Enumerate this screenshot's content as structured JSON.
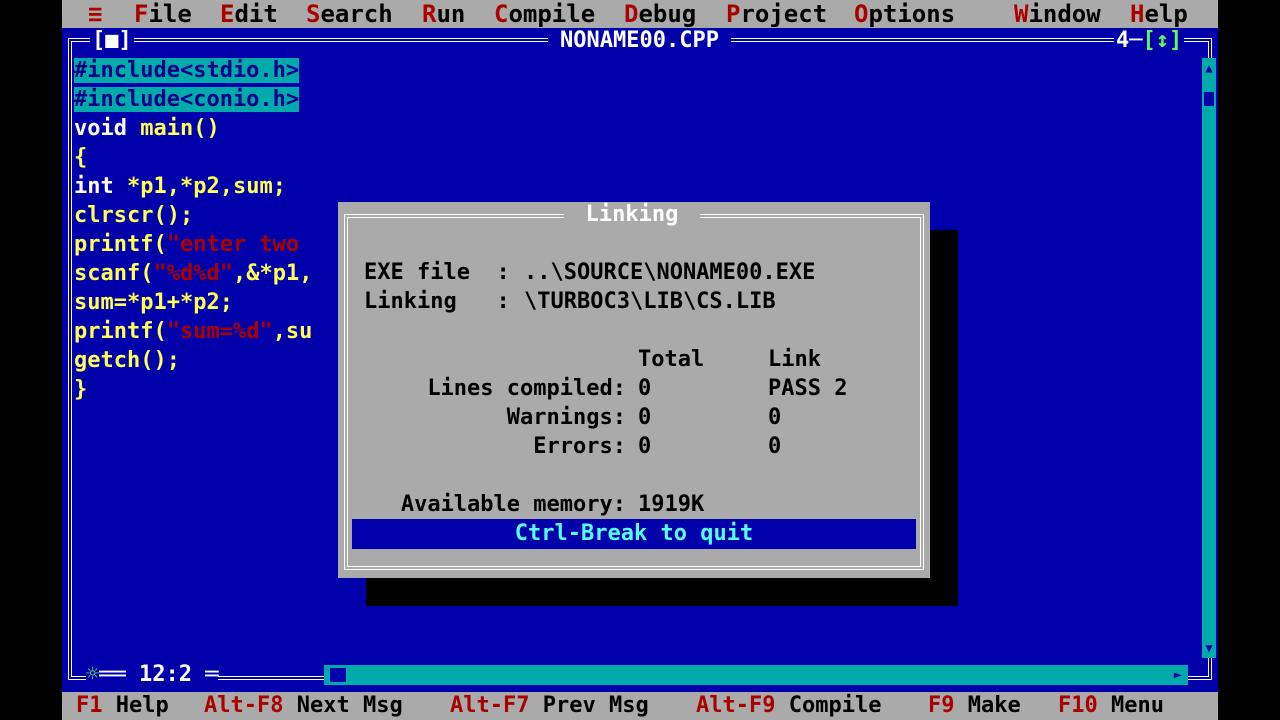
{
  "menu": {
    "system": "≡",
    "items": [
      {
        "hot": "F",
        "rest": "ile"
      },
      {
        "hot": "E",
        "rest": "dit"
      },
      {
        "hot": "S",
        "rest": "earch"
      },
      {
        "hot": "R",
        "rest": "un"
      },
      {
        "hot": "C",
        "rest": "ompile"
      },
      {
        "hot": "D",
        "rest": "ebug"
      },
      {
        "hot": "P",
        "rest": "roject"
      },
      {
        "hot": "O",
        "rest": "ptions"
      },
      {
        "hot": "W",
        "rest": "indow"
      },
      {
        "hot": "H",
        "rest": "elp"
      }
    ]
  },
  "window": {
    "close_box": "[■]",
    "title": "NONAME00.CPP",
    "number": "4",
    "zoom": "[↕]",
    "cursor_position": "12:2"
  },
  "code": {
    "line1": "#include<stdio.h>",
    "line2": "#include<conio.h>",
    "line3_kw": "void",
    "line3_rest": " main()",
    "line4": "{",
    "line5_kw": "int",
    "line5_rest": " *p1,*p2,sum;",
    "line6": "clrscr();",
    "line7_a": "printf(",
    "line7_str": "\"enter two",
    "line8_a": "scanf(",
    "line8_str": "\"%d%d\"",
    "line8_b": ",&*p1,",
    "line9": "sum=*p1+*p2;",
    "line10_a": "printf(",
    "line10_str": "\"sum=%d\"",
    "line10_b": ",su",
    "line11": "getch();",
    "line12": "}"
  },
  "dialog": {
    "title": "Linking",
    "exe_label": "EXE file  :",
    "exe_value": "..\\SOURCE\\NONAME00.EXE",
    "linking_label": "Linking   :",
    "linking_value": "\\TURBOC3\\LIB\\CS.LIB",
    "col_total": "Total",
    "col_link": "Link",
    "rows": [
      {
        "label": "Lines compiled:",
        "total": "0",
        "link": "PASS 2"
      },
      {
        "label": "Warnings:",
        "total": "0",
        "link": "0"
      },
      {
        "label": "Errors:",
        "total": "0",
        "link": "0"
      }
    ],
    "memory_label": "Available memory:",
    "memory_value": "1919K",
    "quit": "Ctrl-Break to quit"
  },
  "helpbar": [
    {
      "key": "F1",
      "label": "Help"
    },
    {
      "key": "Alt-F8",
      "label": "Next Msg"
    },
    {
      "key": "Alt-F7",
      "label": "Prev Msg"
    },
    {
      "key": "Alt-F9",
      "label": "Compile"
    },
    {
      "key": "F9",
      "label": "Make"
    },
    {
      "key": "F10",
      "label": "Menu"
    }
  ],
  "colors": {
    "desktop": "#0000aa",
    "menu_bg": "#aaaaaa",
    "hotkey": "#aa0000",
    "code_text": "#ffff55",
    "highlight": "#00aaaa",
    "quit_bar": "#0000aa"
  }
}
